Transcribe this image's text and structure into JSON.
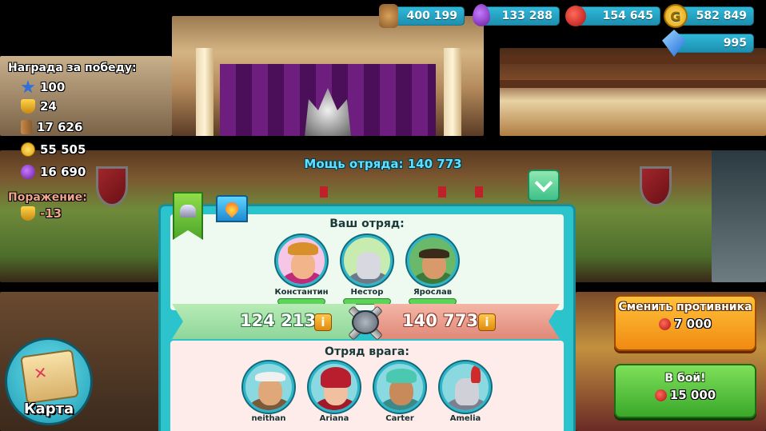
{
  "resources": {
    "wood": "400 199",
    "elixir": "133 288",
    "food": "154 645",
    "gold": "582 849",
    "gems": "995"
  },
  "victory_reward": {
    "title": "Награда за победу:",
    "stars": "100",
    "trophies": "24",
    "wood": "17 626",
    "gold": "55 505",
    "elixir": "16 690"
  },
  "defeat": {
    "title": "Поражение:",
    "trophies": "-13"
  },
  "squad_power_title": "Мощь отряда: 140 773",
  "your_squad": {
    "title": "Ваш отряд:",
    "heroes": [
      {
        "name": "Константин",
        "health": 1.0
      },
      {
        "name": "Нестор",
        "health": 1.0
      },
      {
        "name": "Ярослав",
        "health": 1.0
      }
    ]
  },
  "power_compare": {
    "own": "124 213",
    "enemy": "140 773"
  },
  "enemy_squad": {
    "title": "Отряд врага:",
    "heroes": [
      {
        "name": "neithan"
      },
      {
        "name": "Ariana"
      },
      {
        "name": "Carter"
      },
      {
        "name": "Amelia"
      }
    ]
  },
  "buttons": {
    "change_opponent": {
      "label": "Сменить противника",
      "cost": "7 000",
      "cost_icon": "apple-icon"
    },
    "fight": {
      "label": "В бой!",
      "cost": "15 000",
      "cost_icon": "apple-icon"
    },
    "map": {
      "label": "Карта"
    }
  },
  "colors": {
    "accent_teal": "#2bc4cc",
    "power_title": "#5fe0ff",
    "change_button": "#f5a623",
    "fight_button": "#5cc43c",
    "defeat_text": "#f0a48a"
  }
}
